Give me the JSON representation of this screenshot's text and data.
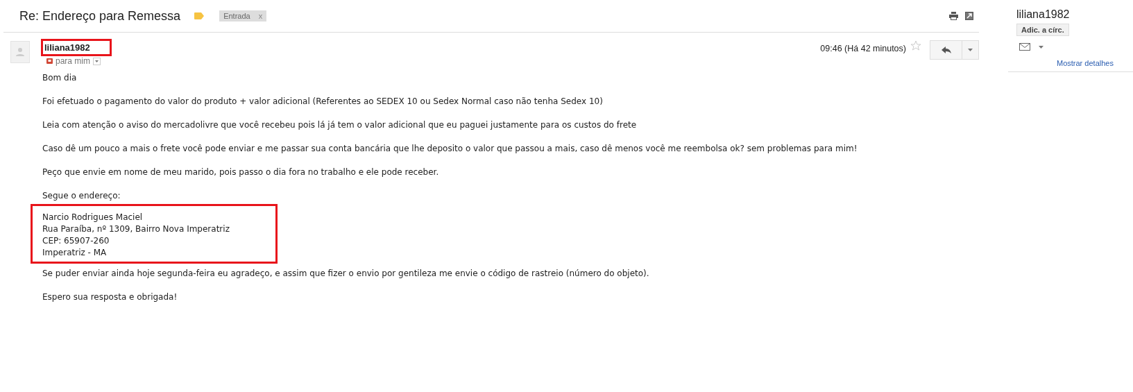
{
  "thread": {
    "subject": "Re: Endereço para Remessa",
    "labels": [
      {
        "text": "Entrada",
        "remove": "x"
      }
    ]
  },
  "message": {
    "sender": "liliana1982",
    "sender_highlighted": true,
    "recipient": "para mim",
    "time": "09:46 (Há 42 minutos)",
    "starred": false,
    "paragraphs": [
      {
        "lines": [
          "Bom dia"
        ],
        "highlighted": false
      },
      {
        "lines": [
          "Foi efetuado o pagamento do valor do produto + valor adicional (Referentes ao SEDEX 10 ou Sedex Normal caso não tenha Sedex 10)"
        ],
        "highlighted": false
      },
      {
        "lines": [
          "Leia com atenção o aviso do mercadolivre que você recebeu pois lá já tem o valor adicional que eu paguei justamente para os custos do frete"
        ],
        "highlighted": false
      },
      {
        "lines": [
          "Caso dê um pouco a mais o frete você pode enviar e me passar sua conta bancária que lhe deposito o valor que passou a mais, caso dê menos você me reembolsa ok? sem problemas para mim!"
        ],
        "highlighted": false
      },
      {
        "lines": [
          "Peço que envie em nome de meu marido, pois passo o dia fora no trabalho e ele pode receber."
        ],
        "highlighted": false
      },
      {
        "lines": [
          "Segue o endereço:"
        ],
        "highlighted": false
      },
      {
        "lines": [
          "Narcio Rodrigues Maciel",
          "Rua Paraíba, nº 1309, Bairro Nova Imperatriz",
          "CEP: 65907-260",
          "Imperatriz - MA"
        ],
        "highlighted": true
      },
      {
        "lines": [
          "Se puder enviar ainda hoje segunda-feira eu agradeço, e assim que fizer o envio por gentileza me envie o código de rastreio (número do objeto)."
        ],
        "highlighted": false
      },
      {
        "lines": [
          "Espero sua resposta e obrigada!"
        ],
        "highlighted": false
      }
    ]
  },
  "contact": {
    "name": "liliana1982",
    "add_button": "Adic. a círc.",
    "details_link": "Mostrar detalhes"
  }
}
